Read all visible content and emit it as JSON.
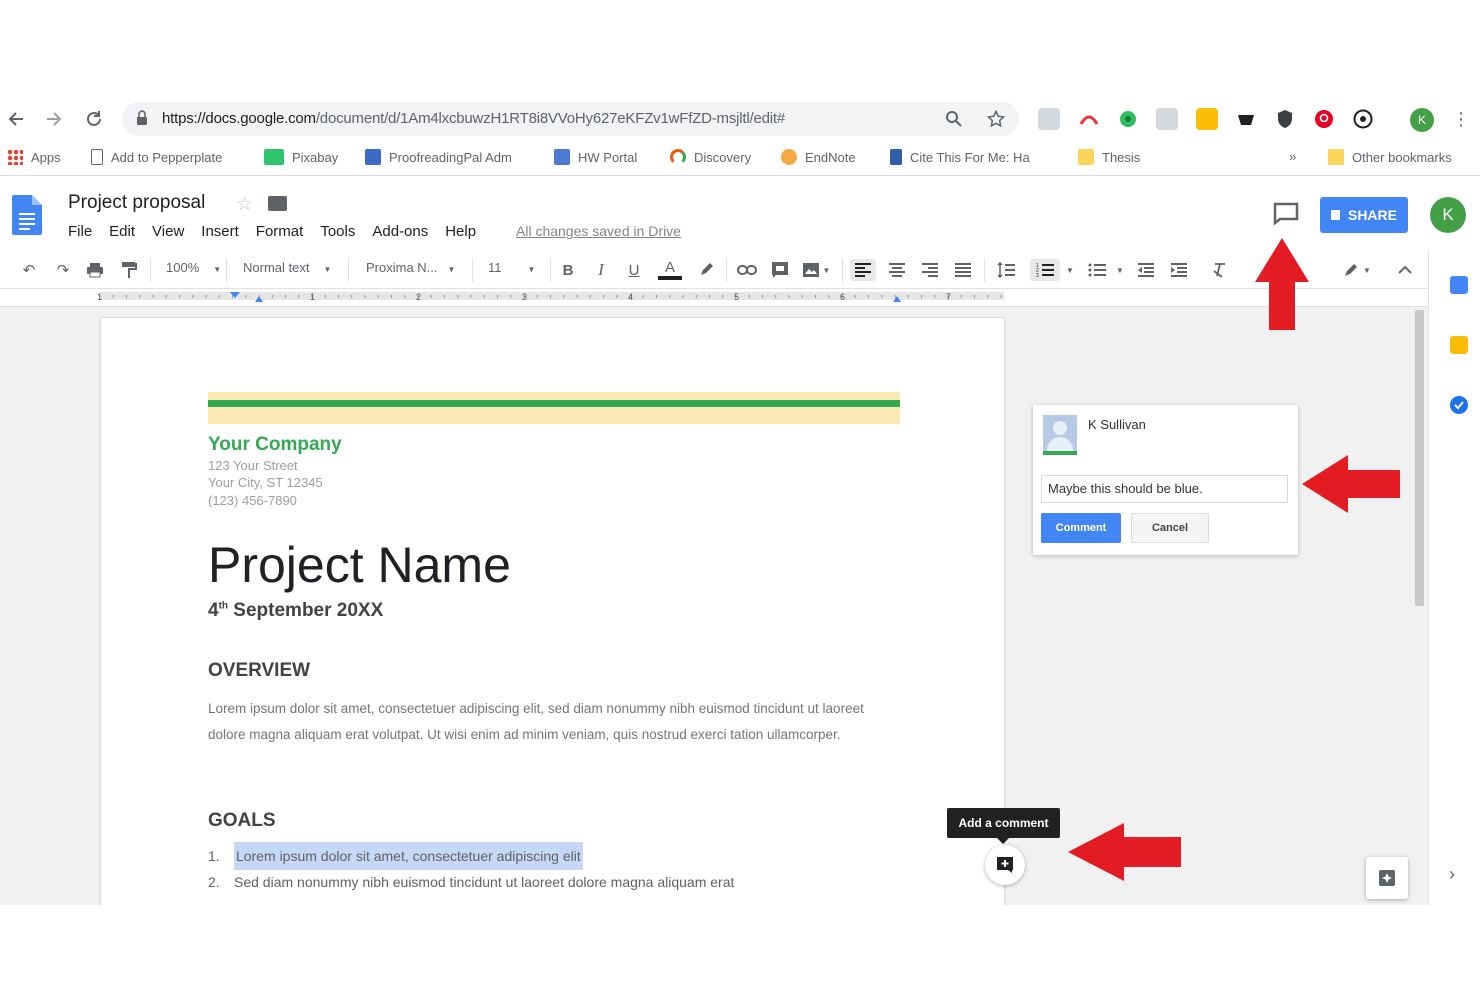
{
  "browser": {
    "url_host": "https://docs.google.com",
    "url_path": "/document/d/1Am4lxcbuwzH1RT8i8VVoHy627eKFZv1wFfZD-msjltl/edit#",
    "bookmarks": [
      {
        "label": "Apps",
        "color": "#db4437"
      },
      {
        "label": "Add to Pepperplate",
        "color": "#ffffff"
      },
      {
        "label": "Pixabay",
        "color": "#2ec66d"
      },
      {
        "label": "ProofreadingPal Adm",
        "color": "#3b6bc4"
      },
      {
        "label": "HW Portal",
        "color": "#4a7bd0"
      },
      {
        "label": "Discovery",
        "color": "#e8590c"
      },
      {
        "label": "EndNote",
        "color": "#f4a742"
      },
      {
        "label": "Cite This For Me: Ha",
        "color": "#2f5fa8"
      },
      {
        "label": "Thesis",
        "color": "#fbd55b"
      }
    ],
    "more_bookmarks": "»",
    "other_bookmarks": "Other bookmarks",
    "profile_initial": "K"
  },
  "docs": {
    "title": "Project proposal",
    "menu": [
      "File",
      "Edit",
      "View",
      "Insert",
      "Format",
      "Tools",
      "Add-ons",
      "Help"
    ],
    "saved_status": "All changes saved in Drive",
    "share_label": "SHARE",
    "avatar_initial": "K"
  },
  "toolbar": {
    "zoom": "100%",
    "style": "Normal text",
    "font": "Proxima N...",
    "font_size": "11"
  },
  "ruler_numbers": [
    "1",
    "1",
    "2",
    "3",
    "4",
    "5",
    "6",
    "7"
  ],
  "document": {
    "company": "Your Company",
    "address_lines": [
      "123 Your Street",
      "Your City, ST 12345",
      "(123) 456-7890"
    ],
    "project_name": "Project Name",
    "date_day": "4",
    "date_suffix": "th",
    "date_rest": " September 20XX",
    "overview_heading": "OVERVIEW",
    "overview_text": "Lorem ipsum dolor sit amet, consectetuer adipiscing elit, sed diam nonummy nibh euismod tincidunt ut laoreet dolore magna aliquam erat volutpat. Ut wisi enim ad minim veniam, quis nostrud exerci tation ullamcorper.",
    "goals_heading": "GOALS",
    "goals": [
      {
        "num": "1.",
        "text": "Lorem ipsum dolor sit amet, consectetuer adipiscing elit"
      },
      {
        "num": "2.",
        "text": "Sed diam nonummy nibh euismod tincidunt ut laoreet dolore magna aliquam erat"
      }
    ]
  },
  "comment": {
    "author": "K Sullivan",
    "text": "Maybe this should be blue.",
    "submit_label": "Comment",
    "cancel_label": "Cancel"
  },
  "add_comment_tooltip": "Add a comment",
  "colors": {
    "accent_blue": "#4285f4",
    "brand_green": "#34a853",
    "annotation_red": "#e31b23"
  }
}
